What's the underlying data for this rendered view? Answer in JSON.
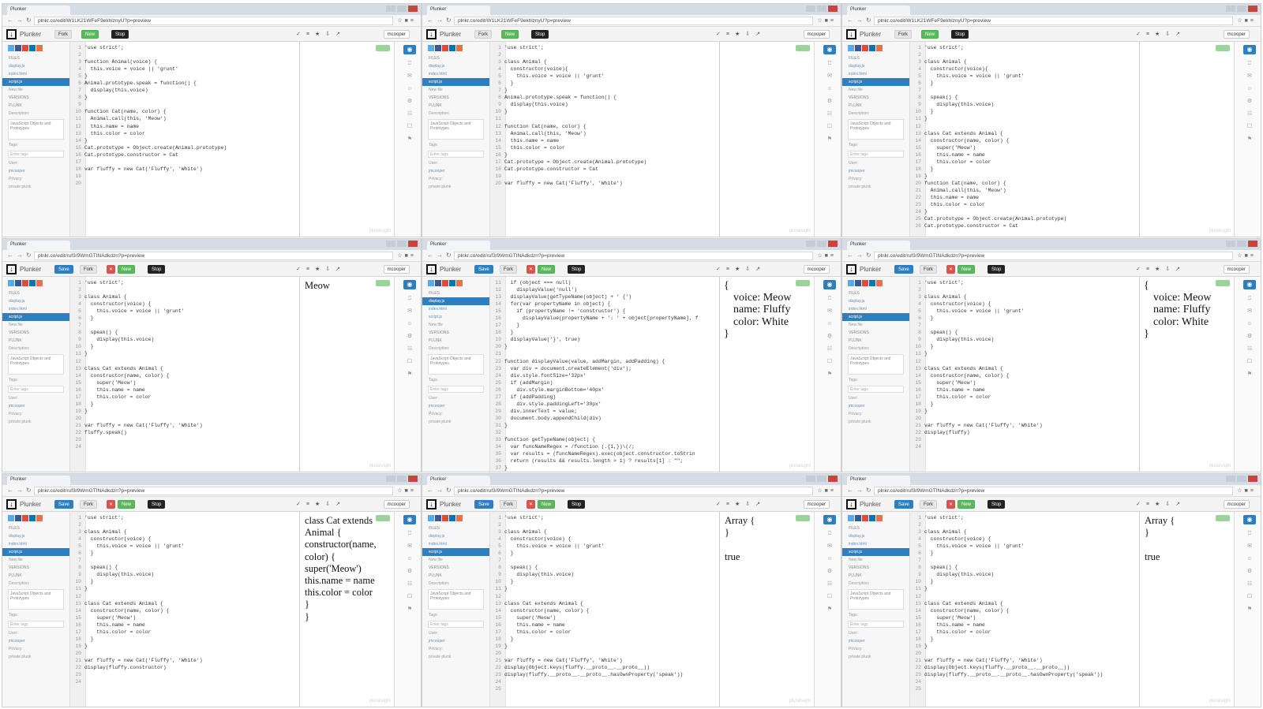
{
  "app": {
    "tab_title": "Plunker",
    "app_name": "Plunker",
    "user": "mcooper",
    "buttons": {
      "save": "Save",
      "fork": "Fork",
      "new": "New",
      "stop": "Stop"
    },
    "watermark": "pluralsight"
  },
  "sidebar": {
    "files_header": "FILES",
    "files": [
      "display.js",
      "index.html",
      "script.js"
    ],
    "new_file": "New file",
    "versions": "VERSIONS",
    "plunk": "PLUNK",
    "description_label": "Description:",
    "description": "JavaScript Objects and Prototypes",
    "tags_label": "Tags:",
    "tags_placeholder": "Enter tags",
    "user_label": "User:",
    "user": "jmcooper",
    "privacy_label": "Privacy:",
    "privacy": "private plunk"
  },
  "panels": [
    {
      "url": "plnkr.co/edit/W1LK21WFeF9ekhlznyU?p=preview",
      "show_save": false,
      "active_file": 2,
      "code": [
        {
          "n": "1",
          "t": "'use strict';"
        },
        {
          "n": "2",
          "t": ""
        },
        {
          "n": "3",
          "t": "function Animal(voice) {"
        },
        {
          "n": "4",
          "t": "  this.voice = voice || 'grunt'"
        },
        {
          "n": "5",
          "t": "}"
        },
        {
          "n": "6",
          "t": "Animal.prototype.speak = function() {"
        },
        {
          "n": "7",
          "t": "  display(this.voice)"
        },
        {
          "n": "8",
          "t": "}"
        },
        {
          "n": "9",
          "t": ""
        },
        {
          "n": "10",
          "t": "function Cat(name, color) {"
        },
        {
          "n": "11",
          "t": "  Animal.call(this, 'Meow')"
        },
        {
          "n": "12",
          "t": "  this.name = name"
        },
        {
          "n": "13",
          "t": "  this.color = color"
        },
        {
          "n": "14",
          "t": "}"
        },
        {
          "n": "15",
          "t": "Cat.prototype = Object.create(Animal.prototype)"
        },
        {
          "n": "16",
          "t": "Cat.prototype.constructor = Cat"
        },
        {
          "n": "17",
          "t": ""
        },
        {
          "n": "18",
          "t": "var fluffy = new Cat('Fluffy', 'White')"
        },
        {
          "n": "19",
          "t": ""
        },
        {
          "n": "20",
          "t": ""
        }
      ],
      "output": []
    },
    {
      "url": "plnkr.co/edit/W1LK21WFeF9ekhlznyU?p=preview",
      "show_save": false,
      "active_file": 2,
      "code": [
        {
          "n": "1",
          "t": "'use strict';"
        },
        {
          "n": "2",
          "t": ""
        },
        {
          "n": "3",
          "t": "class Animal {"
        },
        {
          "n": "4",
          "t": "  constructor(voice){"
        },
        {
          "n": "5",
          "t": "    this.voice = voice || 'grunt'"
        },
        {
          "n": "6",
          "t": "  }"
        },
        {
          "n": "7",
          "t": "}"
        },
        {
          "n": "8",
          "t": "Animal.prototype.speak = function() {"
        },
        {
          "n": "9",
          "t": "  display(this.voice)"
        },
        {
          "n": "10",
          "t": "}"
        },
        {
          "n": "11",
          "t": ""
        },
        {
          "n": "12",
          "t": "function Cat(name, color) {"
        },
        {
          "n": "13",
          "t": "  Animal.call(this, 'Meow')"
        },
        {
          "n": "14",
          "t": "  this.name = name"
        },
        {
          "n": "15",
          "t": "  this.color = color"
        },
        {
          "n": "16",
          "t": "}"
        },
        {
          "n": "17",
          "t": "Cat.prototype = Object.create(Animal.prototype)"
        },
        {
          "n": "18",
          "t": "Cat.prototype.constructor = Cat"
        },
        {
          "n": "19",
          "t": ""
        },
        {
          "n": "20",
          "t": "var fluffy = new Cat('Fluffy', 'White')"
        }
      ],
      "output": []
    },
    {
      "url": "plnkr.co/edit/W1LK21WFeF9ekhlznyU?p=preview",
      "show_save": false,
      "active_file": 2,
      "code": [
        {
          "n": "1",
          "t": "'use strict';"
        },
        {
          "n": "2",
          "t": ""
        },
        {
          "n": "3",
          "t": "class Animal {"
        },
        {
          "n": "4",
          "t": "  constructor(voice){"
        },
        {
          "n": "5",
          "t": "    this.voice = voice || 'grunt'"
        },
        {
          "n": "6",
          "t": "  }"
        },
        {
          "n": "7",
          "t": ""
        },
        {
          "n": "8",
          "t": "  speak() {"
        },
        {
          "n": "9",
          "t": "    display(this.voice)"
        },
        {
          "n": "10",
          "t": "  }"
        },
        {
          "n": "11",
          "t": "}"
        },
        {
          "n": "12",
          "t": ""
        },
        {
          "n": "13",
          "t": "class Cat extends Animal {"
        },
        {
          "n": "14",
          "t": "  constructor(name, color) {"
        },
        {
          "n": "15",
          "t": "    super('Meow')"
        },
        {
          "n": "16",
          "t": "    this.name = name"
        },
        {
          "n": "17",
          "t": "    this.color = color"
        },
        {
          "n": "18",
          "t": "  }"
        },
        {
          "n": "19",
          "t": "}"
        },
        {
          "n": "20",
          "t": "function Cat(name, color) {"
        },
        {
          "n": "21",
          "t": "  Animal.call(this, 'Meow')"
        },
        {
          "n": "22",
          "t": "  this.name = name"
        },
        {
          "n": "23",
          "t": "  this.color = color"
        },
        {
          "n": "24",
          "t": "}"
        },
        {
          "n": "25",
          "t": "Cat.prototype = Object.create(Animal.prototype)"
        },
        {
          "n": "26",
          "t": "Cat.prototype.constructor = Cat"
        }
      ],
      "output": []
    },
    {
      "url": "plnkr.co/edit/ruf3/9WmGTINAdkdzn?p=preview",
      "show_save": true,
      "active_file": 2,
      "code": [
        {
          "n": "1",
          "t": "'use strict';"
        },
        {
          "n": "2",
          "t": ""
        },
        {
          "n": "3",
          "t": "class Animal {"
        },
        {
          "n": "4",
          "t": "  constructor(voice) {"
        },
        {
          "n": "5",
          "t": "    this.voice = voice || 'grunt'"
        },
        {
          "n": "6",
          "t": "  }"
        },
        {
          "n": "7",
          "t": ""
        },
        {
          "n": "8",
          "t": "  speak() {"
        },
        {
          "n": "9",
          "t": "    display(this.voice)"
        },
        {
          "n": "10",
          "t": "  }"
        },
        {
          "n": "11",
          "t": "}"
        },
        {
          "n": "12",
          "t": ""
        },
        {
          "n": "13",
          "t": "class Cat extends Animal {"
        },
        {
          "n": "14",
          "t": "  constructor(name, color) {"
        },
        {
          "n": "15",
          "t": "    super('Meow')"
        },
        {
          "n": "16",
          "t": "    this.name = name"
        },
        {
          "n": "17",
          "t": "    this.color = color"
        },
        {
          "n": "18",
          "t": "  }"
        },
        {
          "n": "19",
          "t": "}"
        },
        {
          "n": "20",
          "t": ""
        },
        {
          "n": "21",
          "t": "var fluffy = new Cat('Fluffy', 'White')"
        },
        {
          "n": "22",
          "t": "fluffy.speak()"
        },
        {
          "n": "23",
          "t": ""
        },
        {
          "n": "24",
          "t": ""
        }
      ],
      "output": [
        "Meow"
      ]
    },
    {
      "url": "plnkr.co/edit/ruf3/9WmGTINAdkdzn?p=preview",
      "show_save": true,
      "active_file": 0,
      "code": [
        {
          "n": "11",
          "t": "  if (object === null)"
        },
        {
          "n": "12",
          "t": "    displayValue('null')"
        },
        {
          "n": "13",
          "t": "  displayValue(getTypeName(object) + ' {')"
        },
        {
          "n": "14",
          "t": "  for(var propertyName in object) {"
        },
        {
          "n": "15",
          "t": "    if (propertyName != 'constructor') {"
        },
        {
          "n": "16",
          "t": "      displayValue(propertyName + ': ' + object[propertyName], f"
        },
        {
          "n": "17",
          "t": "    }"
        },
        {
          "n": "18",
          "t": "  }"
        },
        {
          "n": "19",
          "t": "  displayValue('}', true)"
        },
        {
          "n": "20",
          "t": "}"
        },
        {
          "n": "21",
          "t": ""
        },
        {
          "n": "22",
          "t": "function displayValue(value, addMargin, addPadding) {"
        },
        {
          "n": "23",
          "t": "  var div = document.createElement('div');"
        },
        {
          "n": "24",
          "t": "  div.style.fontSize='32px'"
        },
        {
          "n": "25",
          "t": "  if (addMargin)"
        },
        {
          "n": "26",
          "t": "    div.style.marginBottom='40px'"
        },
        {
          "n": "27",
          "t": "  if (addPadding)"
        },
        {
          "n": "28",
          "t": "    div.style.paddingLeft='30px'"
        },
        {
          "n": "29",
          "t": "  div.innerText = value;"
        },
        {
          "n": "30",
          "t": "  document.body.appendChild(div)"
        },
        {
          "n": "31",
          "t": "}"
        },
        {
          "n": "32",
          "t": ""
        },
        {
          "n": "33",
          "t": "function getTypeName(object) {"
        },
        {
          "n": "34",
          "t": "  var funcNameRegex = /function (.{1,})\\(/;"
        },
        {
          "n": "35",
          "t": "  var results = (funcNameRegex).exec(object.constructor.toStrin"
        },
        {
          "n": "36",
          "t": "  return (results && results.length > 1) ? results[1] : \"\";"
        },
        {
          "n": "37",
          "t": "}"
        }
      ],
      "output": [
        "{",
        "voice: Meow",
        "name: Fluffy",
        "color: White",
        "}"
      ]
    },
    {
      "url": "plnkr.co/edit/ruf3/9WmGTINAdkdzn?p=preview",
      "show_save": true,
      "active_file": 2,
      "code": [
        {
          "n": "1",
          "t": "'use strict';"
        },
        {
          "n": "2",
          "t": ""
        },
        {
          "n": "3",
          "t": "class Animal {"
        },
        {
          "n": "4",
          "t": "  constructor(voice) {"
        },
        {
          "n": "5",
          "t": "    this.voice = voice || 'grunt'"
        },
        {
          "n": "6",
          "t": "  }"
        },
        {
          "n": "7",
          "t": ""
        },
        {
          "n": "8",
          "t": "  speak() {"
        },
        {
          "n": "9",
          "t": "    display(this.voice)"
        },
        {
          "n": "10",
          "t": "  }"
        },
        {
          "n": "11",
          "t": "}"
        },
        {
          "n": "12",
          "t": ""
        },
        {
          "n": "13",
          "t": "class Cat extends Animal {"
        },
        {
          "n": "14",
          "t": "  constructor(name, color) {"
        },
        {
          "n": "15",
          "t": "    super('Meow')"
        },
        {
          "n": "16",
          "t": "    this.name = name"
        },
        {
          "n": "17",
          "t": "    this.color = color"
        },
        {
          "n": "18",
          "t": "  }"
        },
        {
          "n": "19",
          "t": "}"
        },
        {
          "n": "20",
          "t": ""
        },
        {
          "n": "21",
          "t": "var fluffy = new Cat('Fluffy', 'White')"
        },
        {
          "n": "22",
          "t": "display(fluffy)"
        },
        {
          "n": "23",
          "t": ""
        },
        {
          "n": "24",
          "t": ""
        }
      ],
      "output": [
        "{",
        "voice: Meow",
        "name: Fluffy",
        "color: White",
        "}"
      ]
    },
    {
      "url": "plnkr.co/edit/ruf3/9WmGTINAdkdzn?p=preview",
      "show_save": true,
      "active_file": 2,
      "code": [
        {
          "n": "1",
          "t": "'use strict';"
        },
        {
          "n": "2",
          "t": ""
        },
        {
          "n": "3",
          "t": "class Animal {"
        },
        {
          "n": "4",
          "t": "  constructor(voice) {"
        },
        {
          "n": "5",
          "t": "    this.voice = voice || 'grunt'"
        },
        {
          "n": "6",
          "t": "  }"
        },
        {
          "n": "7",
          "t": ""
        },
        {
          "n": "8",
          "t": "  speak() {"
        },
        {
          "n": "9",
          "t": "    display(this.voice)"
        },
        {
          "n": "10",
          "t": "  }"
        },
        {
          "n": "11",
          "t": "}"
        },
        {
          "n": "12",
          "t": ""
        },
        {
          "n": "13",
          "t": "class Cat extends Animal {"
        },
        {
          "n": "14",
          "t": "  constructor(name, color) {"
        },
        {
          "n": "15",
          "t": "    super('Meow')"
        },
        {
          "n": "16",
          "t": "    this.name = name"
        },
        {
          "n": "17",
          "t": "    this.color = color"
        },
        {
          "n": "18",
          "t": "  }"
        },
        {
          "n": "19",
          "t": "}"
        },
        {
          "n": "20",
          "t": ""
        },
        {
          "n": "21",
          "t": "var fluffy = new Cat('Fluffy', 'White')"
        },
        {
          "n": "22",
          "t": "display(fluffy.constructor)"
        },
        {
          "n": "23",
          "t": ""
        },
        {
          "n": "24",
          "t": ""
        }
      ],
      "output": [
        "class Cat extends",
        "Animal {",
        "constructor(name,",
        "color) {",
        "super('Meow')",
        "this.name = name",
        "this.color = color",
        "}",
        "}"
      ]
    },
    {
      "url": "plnkr.co/edit/ruf3/9WmGTINAdkdzn?p=preview",
      "show_save": true,
      "active_file": 2,
      "code": [
        {
          "n": "1",
          "t": "'use strict';"
        },
        {
          "n": "2",
          "t": ""
        },
        {
          "n": "3",
          "t": "class Animal {"
        },
        {
          "n": "4",
          "t": "  constructor(voice) {"
        },
        {
          "n": "5",
          "t": "    this.voice = voice || 'grunt'"
        },
        {
          "n": "6",
          "t": "  }"
        },
        {
          "n": "7",
          "t": ""
        },
        {
          "n": "8",
          "t": "  speak() {"
        },
        {
          "n": "9",
          "t": "    display(this.voice)"
        },
        {
          "n": "10",
          "t": "  }"
        },
        {
          "n": "11",
          "t": "}"
        },
        {
          "n": "12",
          "t": ""
        },
        {
          "n": "13",
          "t": "class Cat extends Animal {"
        },
        {
          "n": "14",
          "t": "  constructor(name, color) {"
        },
        {
          "n": "15",
          "t": "    super('Meow')"
        },
        {
          "n": "16",
          "t": "    this.name = name"
        },
        {
          "n": "17",
          "t": "    this.color = color"
        },
        {
          "n": "18",
          "t": "  }"
        },
        {
          "n": "19",
          "t": "}"
        },
        {
          "n": "20",
          "t": ""
        },
        {
          "n": "21",
          "t": "var fluffy = new Cat('Fluffy', 'White')"
        },
        {
          "n": "22",
          "t": "display(Object.keys(fluffy.__proto__.__proto__))"
        },
        {
          "n": "23",
          "t": "display(fluffy.__proto__.__proto__.hasOwnProperty('speak'))"
        },
        {
          "n": "24",
          "t": ""
        },
        {
          "n": "25",
          "t": ""
        }
      ],
      "output": [
        "Array {",
        "}",
        "",
        "true"
      ]
    },
    {
      "url": "plnkr.co/edit/ruf3/9WmGTINAdkdzn?p=preview",
      "show_save": true,
      "active_file": 2,
      "code": [
        {
          "n": "1",
          "t": "'use strict';"
        },
        {
          "n": "2",
          "t": ""
        },
        {
          "n": "3",
          "t": "class Animal {"
        },
        {
          "n": "4",
          "t": "  constructor(voice) {"
        },
        {
          "n": "5",
          "t": "    this.voice = voice || 'grunt'"
        },
        {
          "n": "6",
          "t": "  }"
        },
        {
          "n": "7",
          "t": ""
        },
        {
          "n": "8",
          "t": "  speak() {"
        },
        {
          "n": "9",
          "t": "    display(this.voice)"
        },
        {
          "n": "10",
          "t": "  }"
        },
        {
          "n": "11",
          "t": "}"
        },
        {
          "n": "12",
          "t": ""
        },
        {
          "n": "13",
          "t": "class Cat extends Animal {"
        },
        {
          "n": "14",
          "t": "  constructor(name, color) {"
        },
        {
          "n": "15",
          "t": "    super('Meow')"
        },
        {
          "n": "16",
          "t": "    this.name = name"
        },
        {
          "n": "17",
          "t": "    this.color = color"
        },
        {
          "n": "18",
          "t": "  }"
        },
        {
          "n": "19",
          "t": "}"
        },
        {
          "n": "20",
          "t": ""
        },
        {
          "n": "21",
          "t": "var fluffy = new Cat('Fluffy', 'White')"
        },
        {
          "n": "22",
          "t": "display(Object.keys(fluffy.__proto__.__proto__))"
        },
        {
          "n": "23",
          "t": "display(fluffy.__proto__.__proto__.hasOwnProperty('speak'))"
        },
        {
          "n": "24",
          "t": ""
        },
        {
          "n": "25",
          "t": ""
        }
      ],
      "output": [
        "Array {",
        "}",
        "",
        "true"
      ]
    }
  ],
  "colors": {
    "accent": "#2e7fc2",
    "new_button": "#5cb85c",
    "delete_button": "#d9534f",
    "social": [
      "#55acee",
      "#3b5998",
      "#dd4b39",
      "#0077b5",
      "#e8704b"
    ]
  }
}
